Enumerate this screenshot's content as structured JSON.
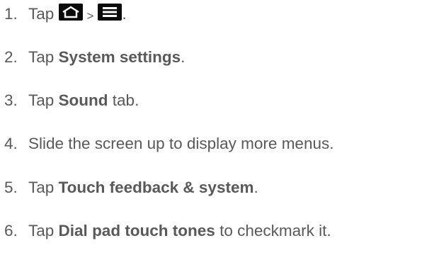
{
  "steps": [
    {
      "num": "1.",
      "tap": "Tap",
      "sep": ">",
      "home_icon": "home-icon",
      "menu_icon": "menu-icon",
      "end": "."
    },
    {
      "num": "2.",
      "pre": "Tap",
      "bold": "System settings",
      "post": "."
    },
    {
      "num": "3.",
      "pre": "Tap",
      "bold": "Sound",
      "post": "tab."
    },
    {
      "num": "4.",
      "text": "Slide the screen up to display more menus."
    },
    {
      "num": "5.",
      "pre": "Tap",
      "bold": "Touch feedback & system",
      "post": "."
    },
    {
      "num": "6.",
      "pre": "Tap",
      "bold": "Dial pad touch tones",
      "post": "to checkmark it."
    }
  ],
  "colors": {
    "text": "#595959",
    "icon_bg": "#0b0b0b",
    "icon_fg": "#ffffff"
  }
}
